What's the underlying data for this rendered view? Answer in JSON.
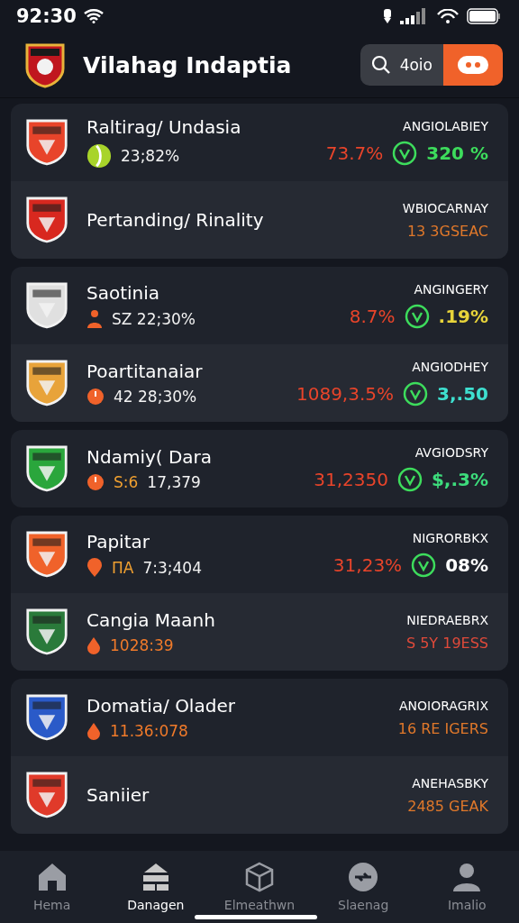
{
  "status_bar": {
    "time": "92:30"
  },
  "header": {
    "title": "Vilahag Indaptia",
    "search": {
      "label": "4oio"
    }
  },
  "groups": [
    {
      "rows": [
        {
          "kind": "stats",
          "name": "Raltirag/ Undasia",
          "sub": {
            "kind": "ball",
            "value": "23;82%",
            "accent": false
          },
          "label": "ANGIOLABIEY",
          "change": "73.7%",
          "score": "320 %",
          "color": "#3ddc5c"
        },
        {
          "kind": "summary",
          "name": "Pertanding/ Rinality",
          "label": "WBIOCARNAY",
          "value": "13 3GSEAC",
          "accent": true
        }
      ]
    },
    {
      "rows": [
        {
          "kind": "stats",
          "name": "Saotinia",
          "sub": {
            "kind": "person",
            "value": "SZ 22;30%",
            "accent": false
          },
          "label": "ANGINGERY",
          "change": "8.7%",
          "score": ".19%",
          "color": "#e8d43a"
        },
        {
          "kind": "stats",
          "name": "Poartitanaiar",
          "sub": {
            "kind": "power",
            "value": "42 28;30%",
            "accent": false
          },
          "label": "ANGIODHEY",
          "change": "1089,3.5%",
          "score": "3,.50",
          "color": "#3ee0d0"
        }
      ]
    },
    {
      "rows": [
        {
          "kind": "stats",
          "name": "Ndamiy( Dara",
          "sub": {
            "kind": "power",
            "prefix": "S:6",
            "value": "17,379",
            "accent": false
          },
          "label": "AVGIODSRY",
          "change": "31,2350",
          "score": "$,.3%",
          "color": "#3ddc7c"
        }
      ]
    },
    {
      "rows": [
        {
          "kind": "stats",
          "name": "Papitar",
          "sub": {
            "kind": "pin",
            "prefix": "ΠA",
            "value": "7:3;404",
            "accent": false
          },
          "label": "NIGRORBKX",
          "change": "31,23%",
          "score": "08%",
          "color": "#ffffff"
        },
        {
          "kind": "summary",
          "name": "Cangia Maanh",
          "sub": {
            "kind": "drop",
            "value": "1028:39",
            "accent": true
          },
          "label": "NIEDRAEBRX",
          "value": "S 5Y 19ESS",
          "accent": false
        }
      ]
    },
    {
      "rows": [
        {
          "kind": "summary",
          "name": "Domatia/ Olader",
          "sub": {
            "kind": "drop",
            "value": "11.36:078",
            "accent": true
          },
          "label": "ANOIORAGRIX",
          "value": "16 RE IGERS",
          "accent": true
        },
        {
          "kind": "summary",
          "name": "Saniier",
          "label": "ANEHASBKY",
          "value": "2485 GEAK",
          "accent": true
        }
      ]
    }
  ],
  "nav": [
    {
      "label": "Hema",
      "selected": false
    },
    {
      "label": "Danagen",
      "selected": true
    },
    {
      "label": "Elmeathwn",
      "selected": false
    },
    {
      "label": "Slaenag",
      "selected": false
    },
    {
      "label": "Imalio",
      "selected": false
    }
  ]
}
